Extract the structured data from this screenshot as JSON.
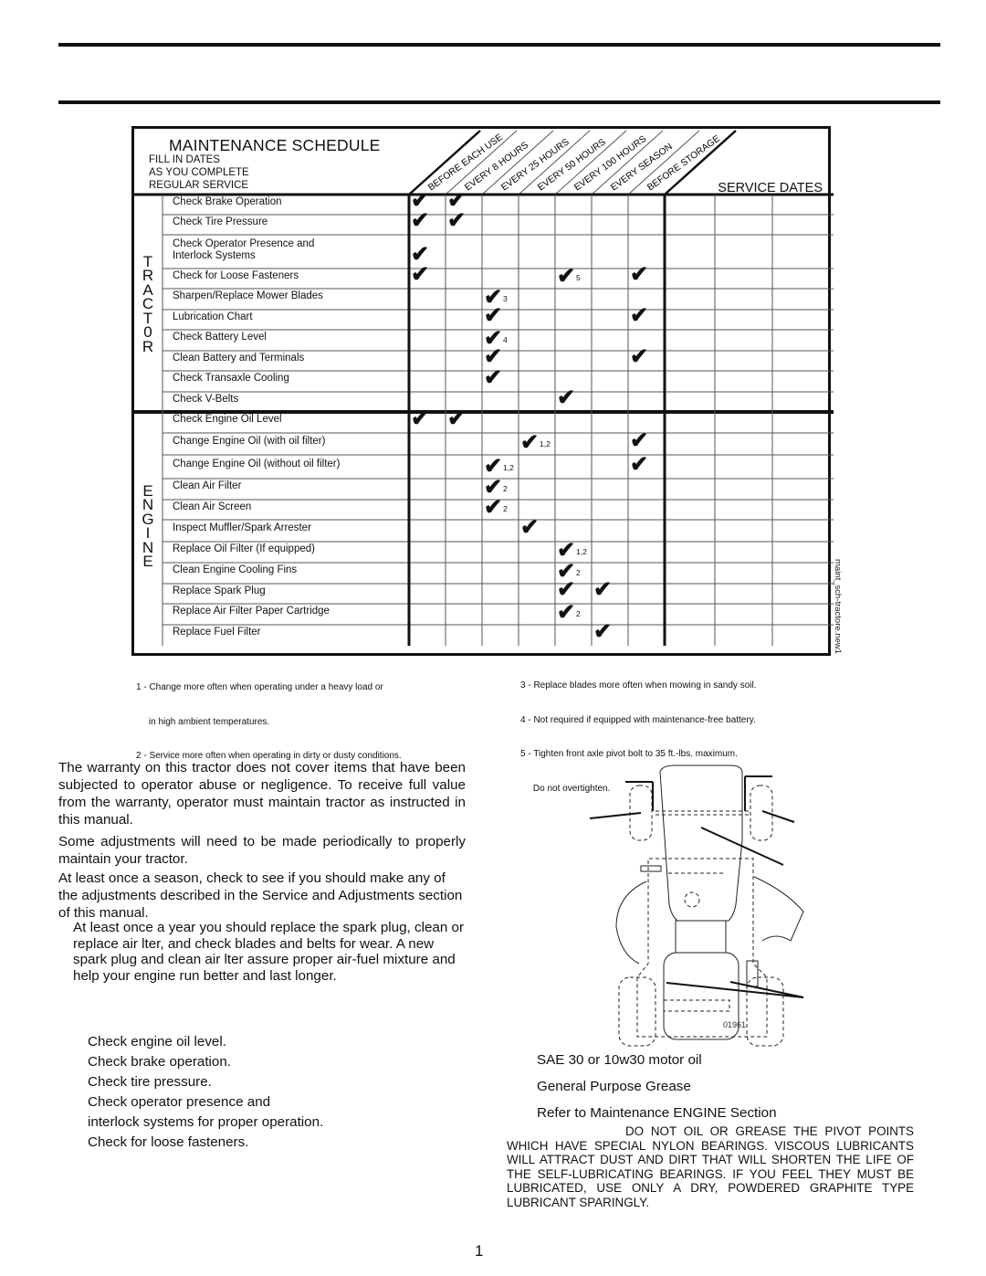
{
  "schedule": {
    "title": "MAINTENANCE SCHEDULE",
    "fill_in": [
      "FILL IN DATES",
      "AS YOU COMPLETE",
      "REGULAR SERVICE"
    ],
    "service_dates_label": "SERVICE DATES",
    "intervals": [
      "BEFORE EACH USE",
      "EVERY 8 HOURS",
      "EVERY 25 HOURS",
      "EVERY 50 HOURS",
      "EVERY 100 HOURS",
      "EVERY SEASON",
      "BEFORE STORAGE"
    ],
    "check_glyph": "✔",
    "sections": [
      {
        "label": [
          "T",
          "R",
          "A",
          "C",
          "T",
          "0",
          "R"
        ],
        "tasks": [
          {
            "name": "Check Brake Operation",
            "checks": [
              {
                "col": 0
              },
              {
                "col": 1
              }
            ]
          },
          {
            "name": "Check Tire Pressure",
            "checks": [
              {
                "col": 0
              },
              {
                "col": 1
              }
            ]
          },
          {
            "name": "Check Operator Presence and\nInterlock Systems",
            "checks": [
              {
                "col": 0
              }
            ]
          },
          {
            "name": "Check for Loose Fasteners",
            "checks": [
              {
                "col": 0
              },
              {
                "col": 4,
                "note": "5"
              },
              {
                "col": 6
              }
            ]
          },
          {
            "name": "Sharpen/Replace Mower Blades",
            "checks": [
              {
                "col": 2,
                "note": "3"
              }
            ]
          },
          {
            "name": "Lubrication Chart",
            "checks": [
              {
                "col": 2
              },
              {
                "col": 6
              }
            ]
          },
          {
            "name": "Check Battery Level",
            "checks": [
              {
                "col": 2,
                "note": "4"
              }
            ]
          },
          {
            "name": "Clean Battery and Terminals",
            "checks": [
              {
                "col": 2
              },
              {
                "col": 6
              }
            ]
          },
          {
            "name": "Check Transaxle Cooling",
            "checks": [
              {
                "col": 2
              }
            ]
          },
          {
            "name": "Check V-Belts",
            "checks": [
              {
                "col": 4
              }
            ]
          }
        ]
      },
      {
        "label": [
          "E",
          "N",
          "G",
          "I",
          "N",
          "E"
        ],
        "tasks": [
          {
            "name": "Check Engine Oil Level",
            "checks": [
              {
                "col": 0
              },
              {
                "col": 1
              }
            ]
          },
          {
            "name": "Change Engine Oil (with oil filter)",
            "checks": [
              {
                "col": 3,
                "note": "1,2"
              },
              {
                "col": 6
              }
            ]
          },
          {
            "name": "Change Engine Oil (without oil filter)",
            "checks": [
              {
                "col": 2,
                "note": "1,2"
              },
              {
                "col": 6
              }
            ]
          },
          {
            "name": "Clean Air Filter",
            "checks": [
              {
                "col": 2,
                "note": "2"
              }
            ]
          },
          {
            "name": "Clean Air Screen",
            "checks": [
              {
                "col": 2,
                "note": "2"
              }
            ]
          },
          {
            "name": "Inspect Muffler/Spark Arrester",
            "checks": [
              {
                "col": 3
              }
            ]
          },
          {
            "name": "Replace Oil Filter (If equipped)",
            "checks": [
              {
                "col": 4,
                "note": "1,2"
              }
            ]
          },
          {
            "name": "Clean Engine Cooling Fins",
            "checks": [
              {
                "col": 4,
                "note": "2"
              }
            ]
          },
          {
            "name": "Replace Spark Plug",
            "checks": [
              {
                "col": 4
              },
              {
                "col": 5
              }
            ]
          },
          {
            "name": "Replace Air Filter Paper Cartridge",
            "checks": [
              {
                "col": 4,
                "note": "2"
              }
            ]
          },
          {
            "name": "Replace Fuel Filter",
            "checks": [
              {
                "col": 5
              }
            ]
          }
        ]
      }
    ],
    "side_label": "maint_sch-tractore.new1"
  },
  "footnotes": {
    "left": [
      "1 - Change more often when operating under a heavy load or",
      "     in high ambient temperatures.",
      "2 - Service more often when operating in dirty or dusty conditions."
    ],
    "right": [
      "3 - Replace blades more often when mowing in sandy soil.",
      "4 - Not required if equipped with maintenance-free battery.",
      "5 - Tighten front axle pivot bolt to 35 ft.-lbs. maximum.",
      "     Do not overtighten."
    ]
  },
  "body": {
    "p1": "The warranty on this tractor does not cover items that have been subjected to operator abuse or negligence. To receive full value from the warranty, operator must maintain tractor as instructed in this manual.",
    "p2": "Some adjustments will need to be made periodically to properly maintain your tractor.",
    "p3": "At least once a season, check to see if you should make any of the adjustments described in the Service and Adjustments section of this manual.",
    "p4": "At least once a year you should replace the spark plug, clean or replace air   lter, and check blades and belts for wear.  A new spark plug and clean air   lter assure proper air-fuel mixture and help your engine run better and last longer.",
    "checklist": [
      "Check engine oil level.",
      "Check brake operation.",
      "Check tire pressure.",
      "Check operator presence and",
      "interlock systems for proper operation.",
      "Check for loose fasteners."
    ]
  },
  "lubrication": {
    "items": [
      "SAE 30 or 10w30 motor oil",
      "General Purpose Grease",
      "Refer to Maintenance  ENGINE  Section"
    ],
    "warning": "DO NOT OIL OR GREASE THE PIVOT POINTS WHICH HAVE SPECIAL NYLON BEARINGS. VISCOUS LUBRICANTS WILL ATTRACT DUST AND DIRT THAT WILL SHORTEN THE LIFE OF THE SELF-LUBRICATING BEARINGS. IF YOU FEEL THEY MUST BE LUBRICATED, USE ONLY A DRY, POWDERED GRAPHITE TYPE LUBRICANT SPARINGLY.",
    "figure_id": "01961"
  },
  "page_number": "1"
}
